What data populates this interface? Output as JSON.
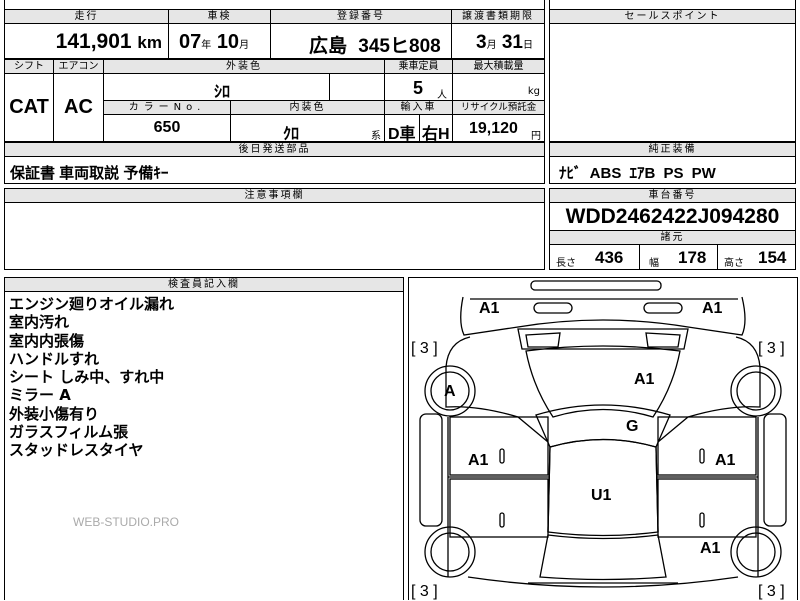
{
  "top": {
    "headers": {
      "mileage": "走行",
      "inspection": "車検",
      "registration": "登録番号",
      "transfer_deadline": "譲渡書類期限"
    },
    "mileage_value": "141,901",
    "mileage_unit": "km",
    "inspection_year": "07",
    "year_unit": "年",
    "inspection_month": "10",
    "month_unit": "月",
    "plate_region": "広島",
    "plate_number": "345ヒ808",
    "transfer_month": "3",
    "transfer_month_unit": "月",
    "transfer_day": "31",
    "transfer_day_unit": "日"
  },
  "specs": {
    "headers": {
      "shift": "シフト",
      "aircon": "エアコン",
      "exterior_color": "外装色",
      "capacity": "乗車定員",
      "max_load": "最大積載量",
      "color_no": "カラーNo.",
      "interior_color": "内装色",
      "import": "輸入車",
      "recycle": "リサイクル預託金"
    },
    "shift": "CAT",
    "aircon": "AC",
    "exterior_color_value": "ｼﾛ",
    "capacity_value": "5",
    "capacity_unit": "人",
    "load_unit": "kg",
    "color_no_value": "650",
    "interior_color_value": "ｸﾛ",
    "interior_suffix": "系",
    "import_type": "D車",
    "steering": "右H",
    "recycle_value": "19,120",
    "recycle_unit": "円"
  },
  "later_parts": {
    "header": "後日発送部品",
    "value": "保証書 車両取説 予備ｷｰ"
  },
  "caution": {
    "header": "注意事項欄",
    "value": ""
  },
  "sales_point": {
    "header": "セールスポイント",
    "value": ""
  },
  "equipment": {
    "header": "純正装備",
    "value": "ﾅﾋﾞ ABS ｴｱB PS PW"
  },
  "chassis": {
    "header": "車台番号",
    "value": "WDD2462422J094280"
  },
  "dimensions": {
    "header": "諸元",
    "length_label": "長さ",
    "length": "436",
    "width_label": "幅",
    "width": "178",
    "height_label": "高さ",
    "height": "154"
  },
  "inspector": {
    "header": "検査員記入欄",
    "notes": [
      "エンジン廻りオイル漏れ",
      "室内汚れ",
      "室内内張傷",
      "ハンドルすれ",
      "シート しみ中、すれ中",
      "ミラー A",
      "外装小傷有り",
      "ガラスフィルム張",
      "スタッドレスタイヤ"
    ],
    "watermark": "WEB-STUDIO.PRO"
  },
  "diagram": {
    "marks": {
      "front_left_corner": "A1",
      "front_right_corner": "A1",
      "left_front_wheel": "A",
      "bonnet": "A1",
      "windshield": "G",
      "left_front_door": "A1",
      "right_front_door": "A1",
      "roof": "U1",
      "right_rear": "A1"
    },
    "tire_left_top": "3",
    "tire_right_top": "3",
    "tire_left_bottom": "3",
    "tire_right_bottom": "3"
  }
}
